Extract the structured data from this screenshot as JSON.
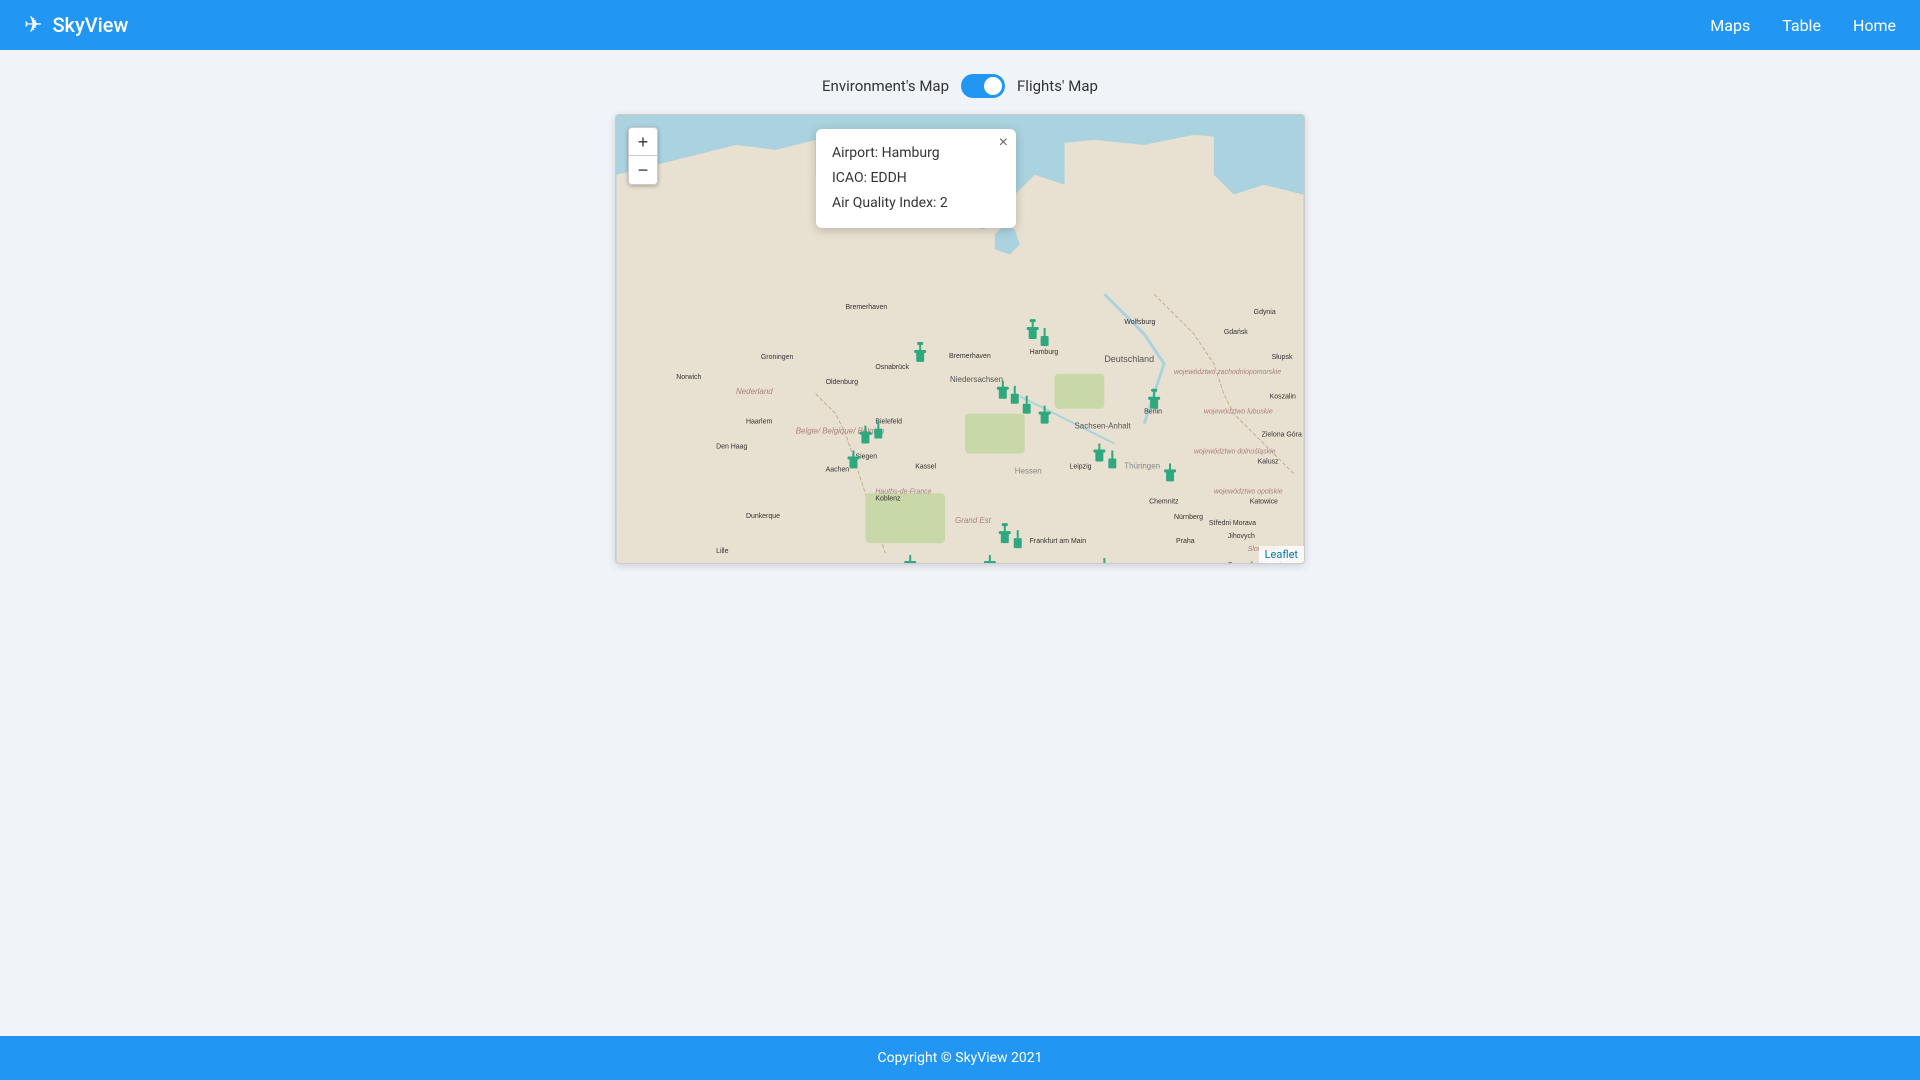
{
  "navbar": {
    "brand": "SkyView",
    "links": [
      {
        "label": "Maps",
        "href": "#"
      },
      {
        "label": "Table",
        "href": "#"
      },
      {
        "label": "Home",
        "href": "#"
      }
    ]
  },
  "map_section": {
    "toggle": {
      "left_label": "Environment's Map",
      "right_label": "Flights' Map",
      "checked": true
    },
    "popup": {
      "airport_label": "Airport: Hamburg",
      "icao_label": "ICAO: EDDH",
      "aqi_label": "Air Quality Index: 2",
      "close_label": "×"
    },
    "zoom": {
      "plus_label": "+",
      "minus_label": "−"
    },
    "attribution": {
      "text": "Leaflet",
      "href": "#"
    }
  },
  "footer": {
    "text": "Copyright © SkyView 2021"
  }
}
